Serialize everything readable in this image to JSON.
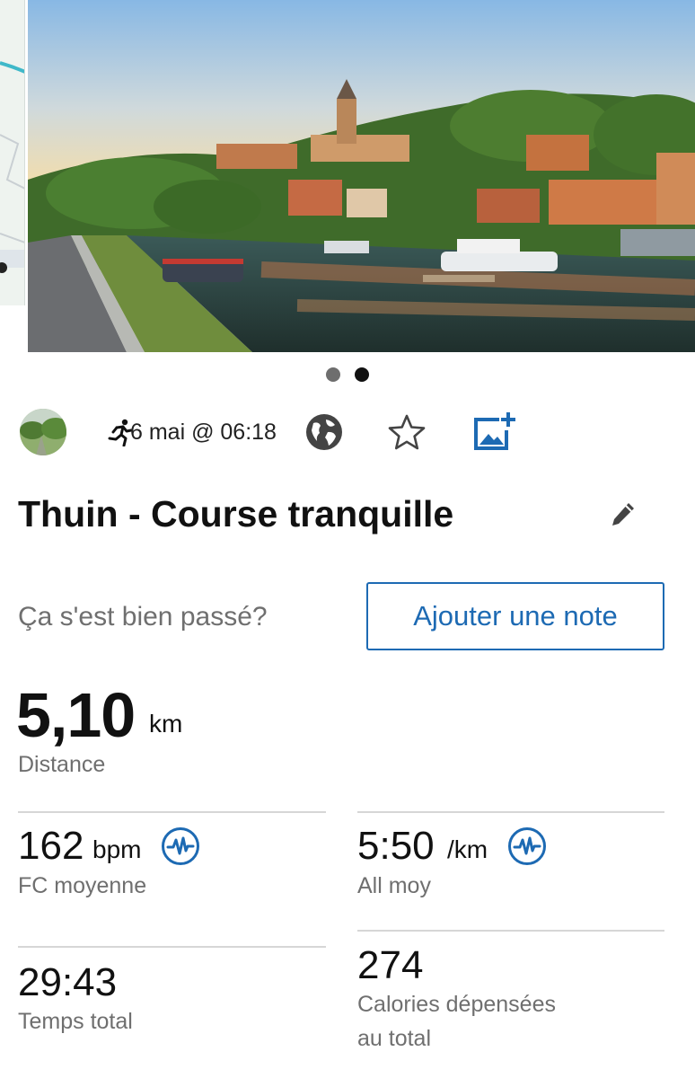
{
  "gallery": {
    "photo_description_icon": "river-town-photo",
    "dots": [
      {
        "active": false
      },
      {
        "active": true
      }
    ]
  },
  "meta": {
    "activity_icon": "running-icon",
    "date": "6 mai @ 06:18",
    "privacy_icon": "globe-icon",
    "favorite_icon": "star-icon",
    "add_photo_icon": "add-photo-icon"
  },
  "activity": {
    "title": "Thuin - Course tranquille"
  },
  "note": {
    "prompt": "Ça s'est bien passé?",
    "button_label": "Ajouter une note"
  },
  "distance": {
    "value": "5,10",
    "unit": "km",
    "label": "Distance"
  },
  "stats": {
    "heart_rate": {
      "value": "162",
      "unit": "bpm",
      "label": "FC moyenne"
    },
    "pace": {
      "value": "5:50",
      "unit": "/km",
      "label": "All moy"
    },
    "total_time": {
      "value": "29:43",
      "label": "Temps total"
    },
    "calories": {
      "value": "274",
      "label_line1": "Calories dépensées",
      "label_line2": "au total"
    }
  },
  "colors": {
    "accent_blue": "#1d6ab3",
    "secondary_text": "#6f6f6f",
    "divider": "#d6d6d6"
  }
}
